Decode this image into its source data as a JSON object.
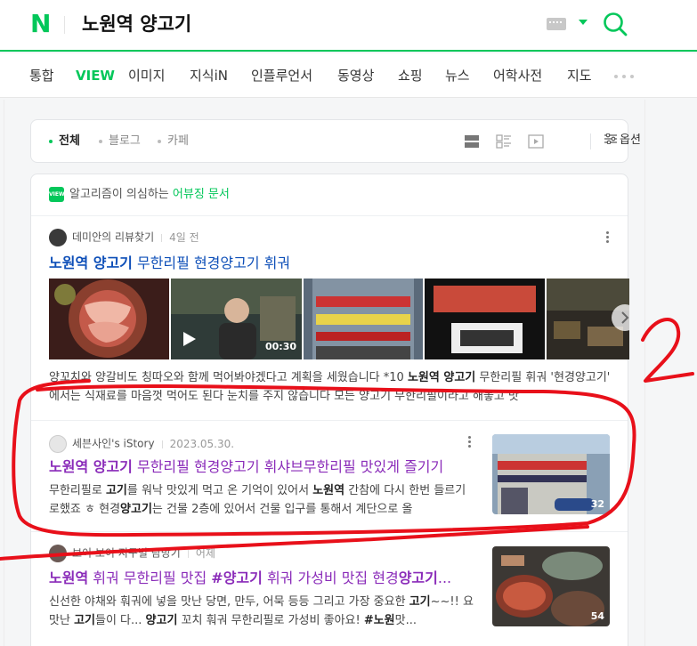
{
  "header": {
    "logo": "N",
    "query": "노원역 양고기"
  },
  "tabs": [
    {
      "label": "통합",
      "active": false
    },
    {
      "label": "VIEW",
      "active": true
    },
    {
      "label": "이미지",
      "active": false
    },
    {
      "label": "지식iN",
      "active": false
    },
    {
      "label": "인플루언서",
      "active": false
    },
    {
      "label": "동영상",
      "active": false
    },
    {
      "label": "쇼핑",
      "active": false
    },
    {
      "label": "뉴스",
      "active": false
    },
    {
      "label": "어학사전",
      "active": false
    },
    {
      "label": "지도",
      "active": false
    }
  ],
  "filter": {
    "options": [
      {
        "label": "전체",
        "selected": true
      },
      {
        "label": "블로그",
        "selected": false
      },
      {
        "label": "카페",
        "selected": false
      }
    ],
    "option_button": "옵션"
  },
  "notice": {
    "badge": "VIEW",
    "text": "알고리즘이 의심하는",
    "link": "어뷰징 문서"
  },
  "posts": [
    {
      "author": "데미안의 리뷰찾기",
      "date": "4일 전",
      "title_bold": "노원역 양고기",
      "title_rest": " 무한리필 현경양고기 휘궈",
      "video_time": "00:30",
      "desc": [
        {
          "t": "양꼬치와 양갈비도 칭따오와 함께 먹어봐야겠다고 계획을 세웠습니다 *10 ",
          "b": false
        },
        {
          "t": "노원역 양고기",
          "b": true
        },
        {
          "t": " 무한리필 휘궈 '현경양고기' 에서는 식재료를 마음껏 먹어도 된다 눈치를 주지 않습니다 모든 양고기 무한리필이라고 해놓고 맛",
          "b": false
        }
      ]
    },
    {
      "author": "세븐사인's iStory",
      "date": "2023.05.30.",
      "title_bold": "노원역 양고기",
      "title_rest": " 무한리필 현경양고기 휘샤브무한리필 맛있게 즐기기",
      "desc": [
        {
          "t": "무한리필로 ",
          "b": false
        },
        {
          "t": "고기",
          "b": true
        },
        {
          "t": "를 워낙 맛있게 먹고 온 기억이 있어서 ",
          "b": false
        },
        {
          "t": "노원역",
          "b": true
        },
        {
          "t": " 간참에 다시 한번 들르기로했죠 ㅎ 현경",
          "b": false
        },
        {
          "t": "양고기",
          "b": true
        },
        {
          "t": "는 건물 2층에 있어서 건물 입구를 통해서 계단으로 올",
          "b": false
        }
      ],
      "image_count": "32"
    },
    {
      "author": "보이 보이 지구별 탐방기",
      "date": "어제",
      "title_html_parts": [
        {
          "t": "노원역",
          "b": true
        },
        {
          "t": " 휘궈 무한리필 맛집 ",
          "b": false
        },
        {
          "t": "#양고기",
          "b": true
        },
        {
          "t": " 휘궈 가성비 맛집 현경",
          "b": false
        },
        {
          "t": "양고기",
          "b": true
        },
        {
          "t": "...",
          "b": false
        }
      ],
      "desc": [
        {
          "t": "신선한 야채와 훠궈에 넣을 맛난 당면, 만두, 어묵 등등 그리고 가장 중요한 ",
          "b": false
        },
        {
          "t": "고기",
          "b": true
        },
        {
          "t": "~~!! 요 맛난 ",
          "b": false
        },
        {
          "t": "고기",
          "b": true
        },
        {
          "t": "들이 다... ",
          "b": false
        },
        {
          "t": "양고기",
          "b": true
        },
        {
          "t": " 꼬치 훠궈 무한리필로 가성비 좋아요! ",
          "b": false
        },
        {
          "t": "#노원",
          "b": true
        },
        {
          "t": "맛...",
          "b": false
        }
      ],
      "image_count": "54"
    }
  ],
  "annotation": {
    "label": "2",
    "color": "#e8101a"
  },
  "colors": {
    "brand": "#03c75a",
    "title_link": "#0e4fb8",
    "visited_link": "#8a2bb9"
  }
}
